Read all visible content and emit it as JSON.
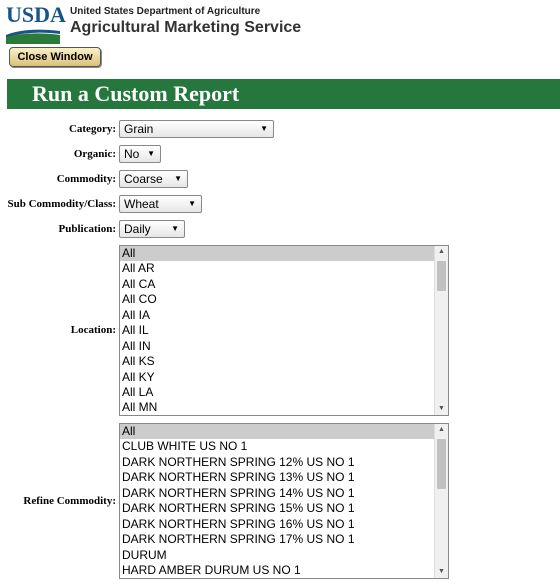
{
  "header": {
    "logo_text": "USDA",
    "department": "United States Department of Agriculture",
    "service": "Agricultural Marketing Service",
    "close_button": "Close Window"
  },
  "banner": {
    "title": "Run a Custom Report"
  },
  "form": {
    "category": {
      "label": "Category:",
      "value": "Grain"
    },
    "organic": {
      "label": "Organic:",
      "value": "No"
    },
    "commodity": {
      "label": "Commodity:",
      "value": "Coarse"
    },
    "sub_commodity": {
      "label": "Sub Commodity/Class:",
      "value": "Wheat"
    },
    "publication": {
      "label": "Publication:",
      "value": "Daily"
    },
    "location": {
      "label": "Location:",
      "options": [
        "All",
        "All AR",
        "All CA",
        "All CO",
        "All IA",
        "All IL",
        "All IN",
        "All KS",
        "All KY",
        "All LA",
        "All MN"
      ],
      "selected": "All"
    },
    "refine_commodity": {
      "label": "Refine Commodity:",
      "options": [
        "All",
        "CLUB WHITE US NO 1",
        "DARK NORTHERN SPRING 12% US NO 1",
        "DARK NORTHERN SPRING 13% US NO 1",
        "DARK NORTHERN SPRING 14% US NO 1",
        "DARK NORTHERN SPRING 15% US NO 1",
        "DARK NORTHERN SPRING 16% US NO 1",
        "DARK NORTHERN SPRING 17% US NO 1",
        "DURUM",
        "HARD AMBER DURUM US NO 1"
      ],
      "selected": "All"
    }
  },
  "icons": {
    "dropdown": "chevron-down-icon",
    "scroll_up": "scroll-up-icon",
    "scroll_down": "scroll-down-icon"
  },
  "colors": {
    "banner": "#25773d",
    "brand_blue": "#18548a",
    "selected_option": "#cccccc"
  }
}
